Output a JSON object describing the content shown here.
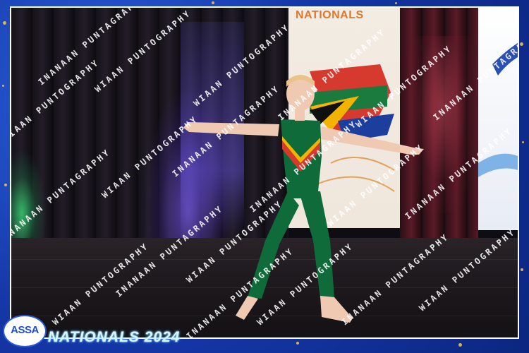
{
  "photo": {
    "subject": "girl in green leotard dancing on stage with arms outstretched",
    "banner_title": "NATIONALS"
  },
  "watermark": {
    "text": "WIAAN PUNTOGRAPHY",
    "alt_text": "INANAAN PUNTAGRAPHY"
  },
  "footer": {
    "logo_text": "ASSA",
    "event_title": "NATIONALS 2024"
  },
  "colors": {
    "frame_blue": "#1a3fb8",
    "accent_gold": "#f2c94c",
    "leotard_green": "#0f6b3a",
    "banner_orange": "#e0782a"
  }
}
